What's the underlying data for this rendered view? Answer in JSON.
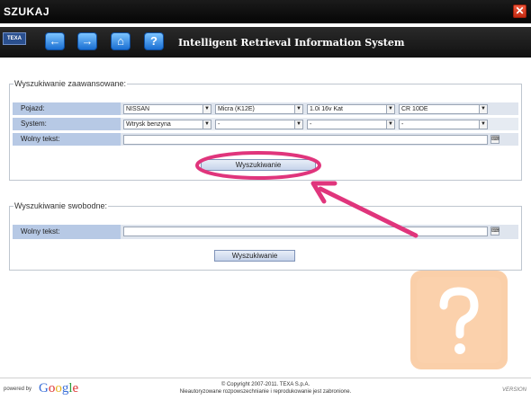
{
  "window": {
    "title": "SZUKAJ",
    "close_glyph": "✕"
  },
  "toolbar": {
    "logo": "TEXA",
    "app_title": "Intelligent Retrieval Information System",
    "buttons": [
      {
        "icon": "arrow-left-icon",
        "glyph": "←"
      },
      {
        "icon": "arrow-right-icon",
        "glyph": "→"
      },
      {
        "icon": "home-icon",
        "glyph": "⌂"
      },
      {
        "icon": "help-icon",
        "glyph": "?"
      }
    ]
  },
  "advanced_search": {
    "legend": "Wyszukiwanie zaawansowane:",
    "vehicle_label": "Pojazd:",
    "vehicle": {
      "make": "NISSAN",
      "model": "Micra (K12E)",
      "engine": "1.0i 16v Kat",
      "code": "CR 10DE"
    },
    "system_label": "System:",
    "system": {
      "system": "Wtrysk benzyna",
      "opt2": "-",
      "opt3": "-",
      "opt4": "-"
    },
    "free_text_label": "Wolny tekst:",
    "free_text_value": "",
    "search_button": "Wyszukiwanie"
  },
  "free_search": {
    "legend": "Wyszukiwanie swobodne:",
    "free_text_label": "Wolny tekst:",
    "free_text_value": "",
    "search_button": "Wyszukiwanie"
  },
  "footer": {
    "powered_by": "powered by",
    "google": "Google",
    "copyright": "© Copyright 2007-2011. TEXA S.p.A.",
    "notice": "Nieautoryzowane rozpowszechnianie i reprodukowanie jest zabronione.",
    "version": "VERSION"
  },
  "colors": {
    "annotation": "#e0357c",
    "help_overlay": "#f9c79a"
  }
}
